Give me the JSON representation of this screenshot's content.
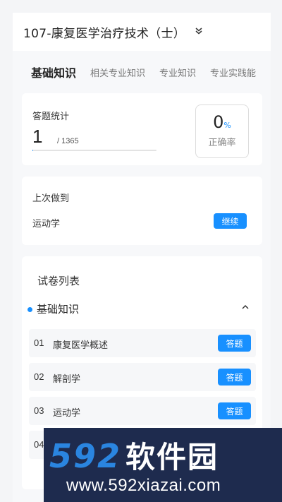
{
  "header": {
    "title": "107-康复医学治疗技术（士）",
    "expand_icon": "double-chevron-down-icon"
  },
  "tabs": [
    {
      "label": "基础知识",
      "active": true
    },
    {
      "label": "相关专业知识",
      "active": false
    },
    {
      "label": "专业知识",
      "active": false
    },
    {
      "label": "专业实践能",
      "active": false
    }
  ],
  "stats": {
    "label": "答题统计",
    "answered": "1",
    "total": "/ 1365",
    "progress_fraction": 0.0007,
    "rate_value": "0",
    "rate_unit": "%",
    "rate_label": "正确率"
  },
  "last": {
    "label": "上次做到",
    "subject": "运动学",
    "continue_label": "继续"
  },
  "papers": {
    "title": "试卷列表",
    "section": {
      "name": "基础知识",
      "collapse_icon": "chevron-up-icon"
    },
    "items": [
      {
        "num": "01",
        "name": "康复医学概述",
        "action": "答题"
      },
      {
        "num": "02",
        "name": "解剖学",
        "action": "答题"
      },
      {
        "num": "03",
        "name": "运动学",
        "action": "答题"
      },
      {
        "num": "04",
        "name": "",
        "action": ""
      }
    ]
  },
  "watermark": {
    "logo_num": "592",
    "logo_cn": "软件园",
    "url": "www.592xiazai.com"
  },
  "colors": {
    "accent": "#1890ff",
    "background": "#f7f8fa",
    "watermark_bg": "#1e2b4e"
  }
}
